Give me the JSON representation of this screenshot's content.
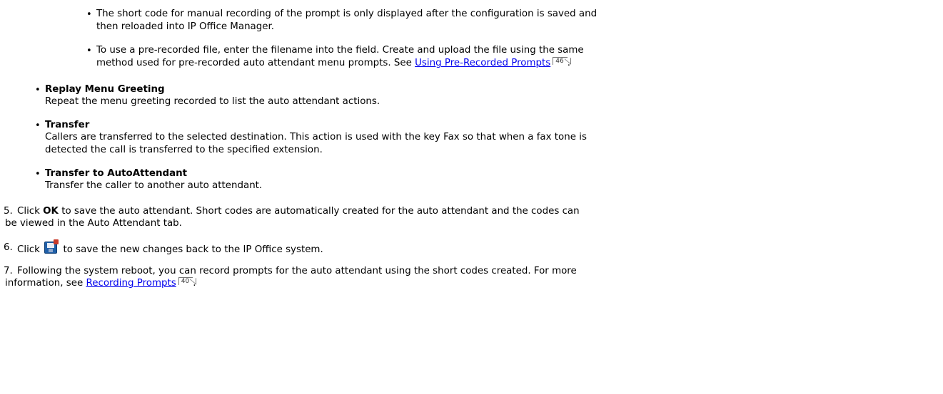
{
  "sub_bullets": [
    {
      "line1": "The short code for manual recording of the prompt is only displayed after the configuration is saved and",
      "line2": "then reloaded into IP Office Manager."
    },
    {
      "line1": "To use a pre-recorded file, enter the filename into the field. Create and upload the file using the same",
      "line2_prefix": "method used for pre-recorded auto attendant menu prompts. See ",
      "link_text": "Using Pre-Recorded Prompts",
      "page_ref": "46",
      "line2_suffix": "."
    }
  ],
  "actions": [
    {
      "title": "Replay Menu Greeting",
      "lines": [
        "Repeat the menu greeting recorded to list the auto attendant actions."
      ]
    },
    {
      "title": "Transfer",
      "lines": [
        "Callers are transferred to the selected destination. This action is used with the key Fax so that when a fax tone is",
        "detected the call is transferred to the specified extension."
      ]
    },
    {
      "title": "Transfer to AutoAttendant",
      "lines": [
        "Transfer the caller to another auto attendant."
      ]
    }
  ],
  "steps": {
    "s5": {
      "num": "5.",
      "pre": "Click ",
      "bold": "OK",
      "post": " to save the auto attendant. Short codes are automatically created for the auto attendant and the codes can",
      "line2": "be viewed in the Auto Attendant tab."
    },
    "s6": {
      "num": "6.",
      "pre": "Click",
      "icon": "save-disk-icon",
      "post": "to save the new changes back to the IP Office system."
    },
    "s7": {
      "num": "7.",
      "line1": "Following the system reboot, you can record prompts for the auto attendant using the short codes created. For more",
      "line2_prefix": "information, see ",
      "link_text": "Recording Prompts",
      "page_ref": "40",
      "line2_suffix": "."
    }
  }
}
